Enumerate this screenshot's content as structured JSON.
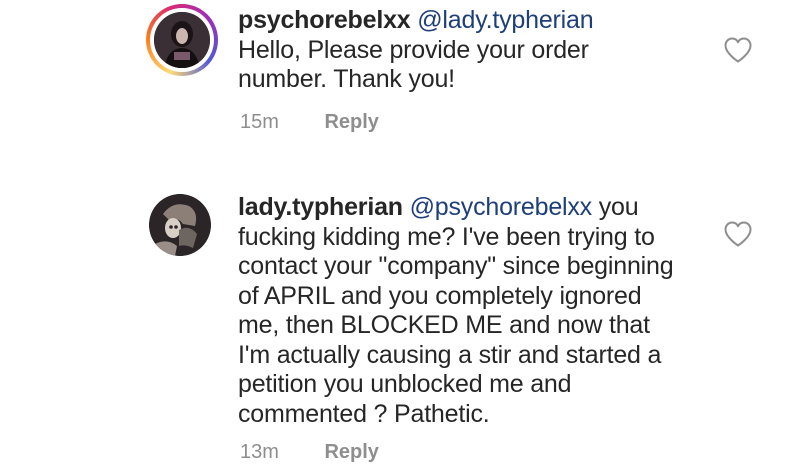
{
  "comments": [
    {
      "username": "psychorebelxx",
      "mention": "@lady.typherian",
      "text": " Hello, Please provide your order number. Thank you!",
      "time": "15m",
      "reply_label": "Reply",
      "avatar_ring": true,
      "like_icon": "heart-outline-icon"
    },
    {
      "username": "lady.typherian",
      "mention": "@psychorebelxx",
      "text": " you fucking kidding me? I've been trying to contact your \"company\" since beginning of APRIL and you completely ignored me, then BLOCKED ME and now that I'm actually causing a stir and started a petition you unblocked me and commented ? Pathetic.",
      "time": "13m",
      "reply_label": "Reply",
      "avatar_ring": false,
      "like_icon": "heart-outline-icon"
    }
  ],
  "colors": {
    "mention": "#1e3f7a",
    "meta_text": "#8e8e8e",
    "body_text": "#262626"
  }
}
